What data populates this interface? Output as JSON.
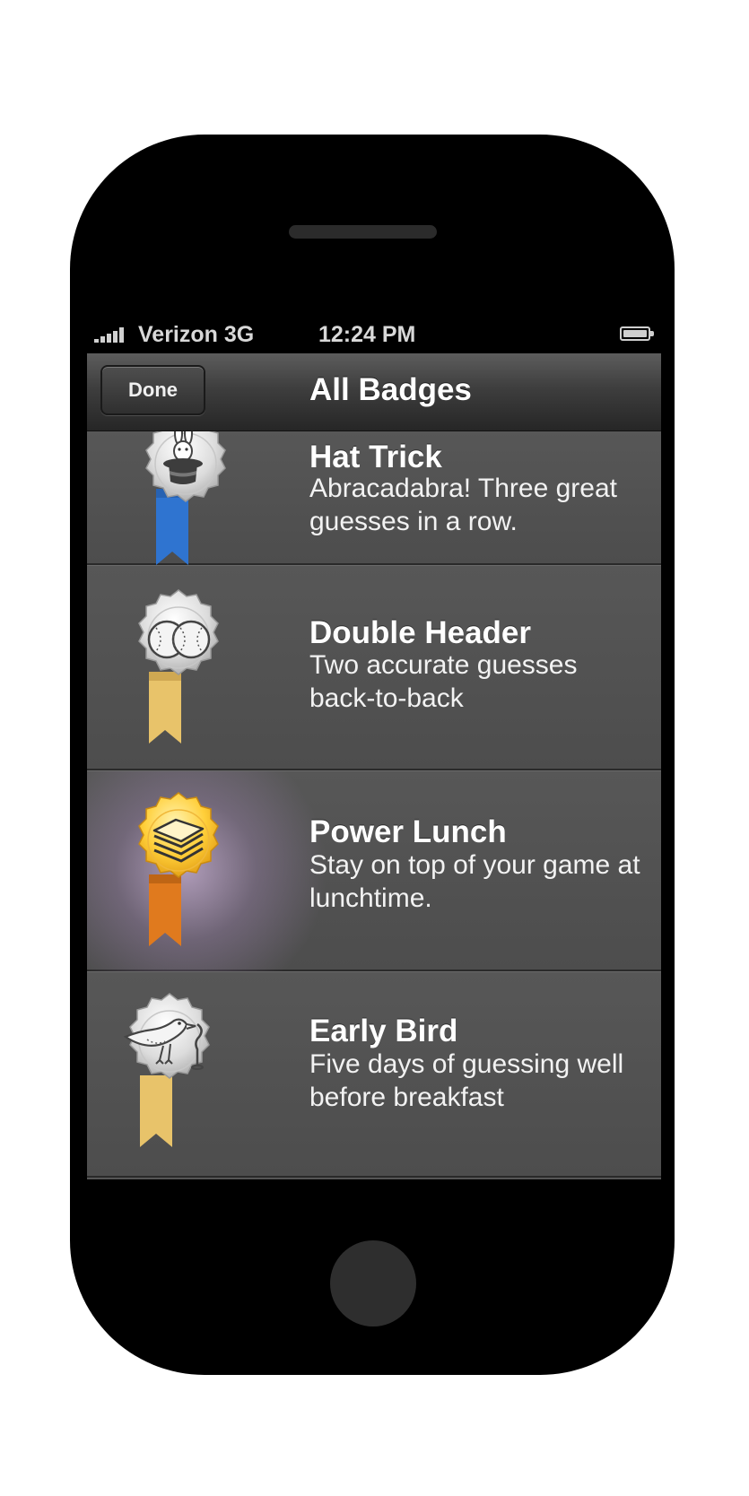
{
  "status_bar": {
    "carrier": "Verizon",
    "network": "3G",
    "time": "12:24 PM"
  },
  "nav": {
    "done_label": "Done",
    "title": "All Badges"
  },
  "badges": [
    {
      "title": "Hat Trick",
      "description": "Abracadabra! Three great guesses in a row.",
      "icon": "magic-hat-rabbit-icon",
      "medal_color": "silver",
      "ribbon_color": "#2f74d0"
    },
    {
      "title": "Double Header",
      "description": "Two accurate guesses back-to-back",
      "icon": "baseballs-icon",
      "medal_color": "silver",
      "ribbon_color": "#e8c36a"
    },
    {
      "title": "Power Lunch",
      "description": "Stay on top of your game at lunchtime.",
      "icon": "sandwich-icon",
      "medal_color": "gold",
      "ribbon_color": "#e07a1e"
    },
    {
      "title": "Early Bird",
      "description": "Five days of guessing well before breakfast",
      "icon": "bird-worm-icon",
      "medal_color": "silver",
      "ribbon_color": "#e8c36a"
    }
  ]
}
